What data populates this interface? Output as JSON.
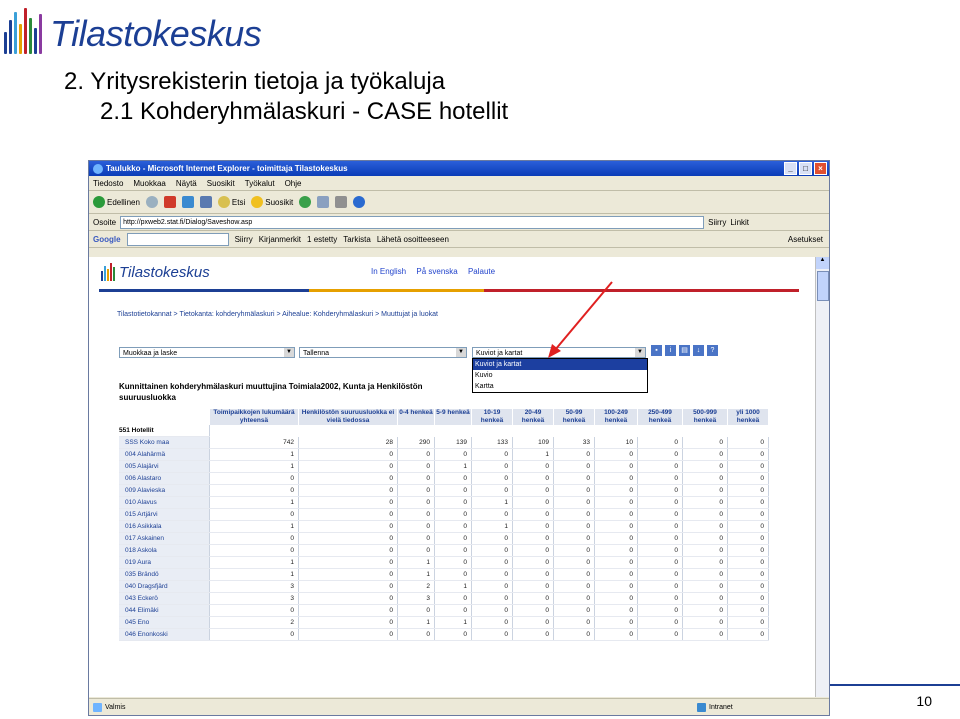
{
  "slide": {
    "logo_text": "Tilastokeskus",
    "title_line1": "2. Yritysrekisterin tietoja ja työkaluja",
    "title_line2": "2.1 Kohderyhmälaskuri - CASE hotellit",
    "page_number": "10"
  },
  "browser": {
    "window_title": "Taulukko - Microsoft Internet Explorer - toimittaja Tilastokeskus",
    "menu": [
      "Tiedosto",
      "Muokkaa",
      "Näytä",
      "Suosikit",
      "Työkalut",
      "Ohje"
    ],
    "toolbar": {
      "back": "Edellinen",
      "search": "Etsi",
      "favorites": "Suosikit"
    },
    "address_label": "Osoite",
    "address_value": "http://pxweb2.stat.fi/Dialog/Saveshow.asp",
    "go_label": "Siirry",
    "links_label": "Linkit",
    "google": {
      "logo": "Google",
      "go": "Siirry",
      "bookmarks": "Kirjanmerkit",
      "blocked": "1 estetty",
      "check": "Tarkista",
      "send": "Lähetä osoitteeseen",
      "settings": "Asetukset"
    },
    "status_left": "Valmis",
    "status_right": "Intranet"
  },
  "page": {
    "logo_text": "Tilastokeskus",
    "lang_links": [
      "In English",
      "På svenska",
      "Palaute"
    ],
    "breadcrumb": "Tilastotietokannat > Tietokanta: kohderyhmälaskuri > Aihealue: Kohderyhmälaskuri > Muuttujat ja luokat",
    "select1": "Muokkaa ja laske",
    "select2": "Tallenna",
    "select3": "Kuviot ja kartat",
    "dropdown_options": [
      "Kuviot ja kartat",
      "Kuvio",
      "Kartta"
    ],
    "icon_buttons": [
      "▪",
      "i",
      "▤",
      "↓",
      "?"
    ],
    "table_title": "Kunnittainen kohderyhmälaskuri muuttujina Toimiala2002, Kunta ja Henkilöstön suuruusluokka",
    "columns": [
      "Toimipaikkojen lukumäärä yhteensä",
      "Henkilöstön suuruusluokka ei vielä tiedossa",
      "0-4 henkeä",
      "5-9 henkeä",
      "10-19 henkeä",
      "20-49 henkeä",
      "50-99 henkeä",
      "100-249 henkeä",
      "250-499 henkeä",
      "500-999 henkeä",
      "yli 1000 henkeä"
    ],
    "group_label": "551 Hotellit",
    "rows": [
      {
        "label": "SSS Koko maa",
        "values": [
          "742",
          "28",
          "290",
          "139",
          "133",
          "109",
          "33",
          "10",
          "0",
          "0",
          "0"
        ]
      },
      {
        "label": "004 Alahärmä",
        "values": [
          "1",
          "0",
          "0",
          "0",
          "0",
          "1",
          "0",
          "0",
          "0",
          "0",
          "0"
        ]
      },
      {
        "label": "005 Alajärvi",
        "values": [
          "1",
          "0",
          "0",
          "1",
          "0",
          "0",
          "0",
          "0",
          "0",
          "0",
          "0"
        ]
      },
      {
        "label": "006 Alastaro",
        "values": [
          "0",
          "0",
          "0",
          "0",
          "0",
          "0",
          "0",
          "0",
          "0",
          "0",
          "0"
        ]
      },
      {
        "label": "009 Alavieska",
        "values": [
          "0",
          "0",
          "0",
          "0",
          "0",
          "0",
          "0",
          "0",
          "0",
          "0",
          "0"
        ]
      },
      {
        "label": "010 Alavus",
        "values": [
          "1",
          "0",
          "0",
          "0",
          "1",
          "0",
          "0",
          "0",
          "0",
          "0",
          "0"
        ]
      },
      {
        "label": "015 Artjärvi",
        "values": [
          "0",
          "0",
          "0",
          "0",
          "0",
          "0",
          "0",
          "0",
          "0",
          "0",
          "0"
        ]
      },
      {
        "label": "016 Asikkala",
        "values": [
          "1",
          "0",
          "0",
          "0",
          "1",
          "0",
          "0",
          "0",
          "0",
          "0",
          "0"
        ]
      },
      {
        "label": "017 Askainen",
        "values": [
          "0",
          "0",
          "0",
          "0",
          "0",
          "0",
          "0",
          "0",
          "0",
          "0",
          "0"
        ]
      },
      {
        "label": "018 Askola",
        "values": [
          "0",
          "0",
          "0",
          "0",
          "0",
          "0",
          "0",
          "0",
          "0",
          "0",
          "0"
        ]
      },
      {
        "label": "019 Aura",
        "values": [
          "1",
          "0",
          "1",
          "0",
          "0",
          "0",
          "0",
          "0",
          "0",
          "0",
          "0"
        ]
      },
      {
        "label": "035 Brändö",
        "values": [
          "1",
          "0",
          "1",
          "0",
          "0",
          "0",
          "0",
          "0",
          "0",
          "0",
          "0"
        ]
      },
      {
        "label": "040 Dragsfjärd",
        "values": [
          "3",
          "0",
          "2",
          "1",
          "0",
          "0",
          "0",
          "0",
          "0",
          "0",
          "0"
        ]
      },
      {
        "label": "043 Eckerö",
        "values": [
          "3",
          "0",
          "3",
          "0",
          "0",
          "0",
          "0",
          "0",
          "0",
          "0",
          "0"
        ]
      },
      {
        "label": "044 Elimäki",
        "values": [
          "0",
          "0",
          "0",
          "0",
          "0",
          "0",
          "0",
          "0",
          "0",
          "0",
          "0"
        ]
      },
      {
        "label": "045 Eno",
        "values": [
          "2",
          "0",
          "1",
          "1",
          "0",
          "0",
          "0",
          "0",
          "0",
          "0",
          "0"
        ]
      },
      {
        "label": "046 Enonkoski",
        "values": [
          "0",
          "0",
          "0",
          "0",
          "0",
          "0",
          "0",
          "0",
          "0",
          "0",
          "0"
        ]
      }
    ]
  },
  "colors": {
    "brand_blue": "#1c3f94",
    "arrow_red": "#e02020",
    "xp_titlebar": "#0a3cb7"
  }
}
